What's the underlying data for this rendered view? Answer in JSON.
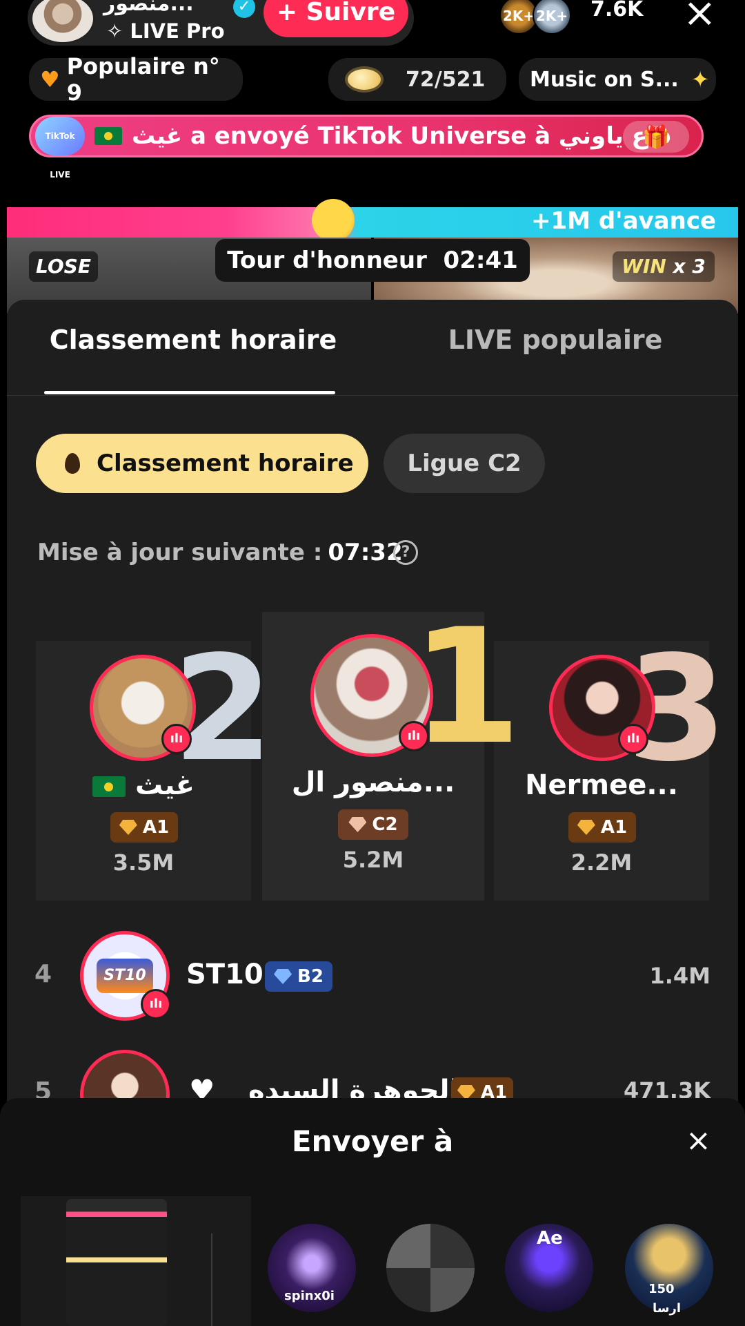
{
  "host": {
    "name": "منصور...",
    "sub_label": "✧ LIVE Pro",
    "follow_label": "+ Suivre",
    "viewer_badges": [
      "2K+",
      "2K+"
    ],
    "viewer_count": "7.6K",
    "close_icon": "×"
  },
  "pills": {
    "popular_label": "Populaire n° 9",
    "planet_progress": "72/521",
    "music_label": "Music on S..."
  },
  "gift_banner": {
    "logo_text": "TikTok LIVE",
    "message": "غيث a envoyé TikTok Universe à قاع ياوني"
  },
  "battle": {
    "lead_text": "+1M d'avance",
    "lose_label": "LOSE",
    "win_label": "WIN",
    "win_multiplier": "x 3",
    "round_label": "Tour d'honneur",
    "timer": "02:41"
  },
  "tabs": {
    "hourly": "Classement horaire",
    "popular": "LIVE populaire"
  },
  "chips": {
    "hourly": "Classement horaire",
    "league": "Ligue C2"
  },
  "next_update": {
    "label": "Mise à jour suivante :",
    "time": "07:32",
    "help_icon": "?"
  },
  "podium": {
    "first": {
      "rank": "1",
      "name": "منصور ال...",
      "league": "C2",
      "score": "5.2M"
    },
    "second": {
      "rank": "2",
      "name": "غيث",
      "league": "A1",
      "score": "3.5M"
    },
    "third": {
      "rank": "3",
      "name": "Nermee...",
      "league": "A1",
      "score": "2.2M"
    }
  },
  "list": [
    {
      "rank": "4",
      "name": "ST10",
      "league": "B2",
      "score": "1.4M",
      "logo_text": "ST10"
    },
    {
      "rank": "5",
      "name": "الجوهرة السيده",
      "league": "A1",
      "score": "471.3K"
    }
  ],
  "send_sheet": {
    "title": "Envoyer à",
    "close_icon": "×",
    "contacts": [
      {
        "label": "spinx0i"
      },
      {
        "label": ""
      },
      {
        "label": "Ae"
      },
      {
        "label": "ارسا",
        "count": "150"
      }
    ]
  },
  "colors": {
    "accent": "#fe2c55",
    "gold_chip": "#fbe08f",
    "battle_pink": "#ff2d7a",
    "battle_cyan": "#27c7ec"
  },
  "icons": {
    "mic_glyph": "ılı",
    "heart_glyph": "♥",
    "gift_glyph": "🎁"
  }
}
